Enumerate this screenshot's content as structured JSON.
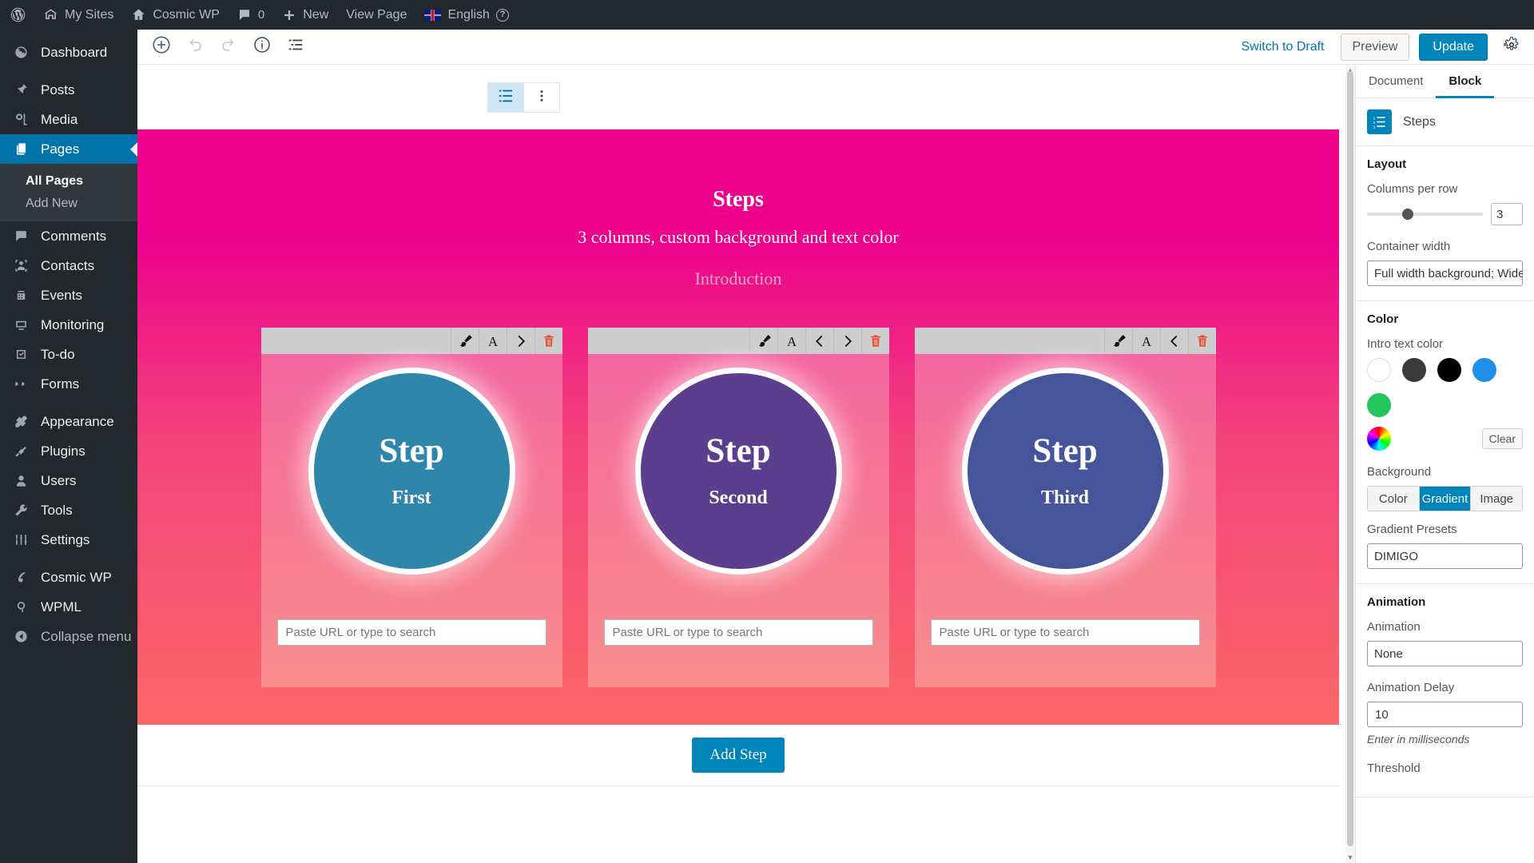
{
  "adminbar": {
    "logo_icon": "wordpress-logo-icon",
    "items": [
      {
        "label": "My Sites",
        "icon": "sites-icon"
      },
      {
        "label": "Cosmic WP",
        "icon": "home-icon"
      },
      {
        "label": "0",
        "icon": "comment-bubble-icon"
      },
      {
        "label": "New",
        "icon": "plus-icon"
      },
      {
        "label": "View Page",
        "icon": ""
      },
      {
        "label": "English",
        "icon": "uk-flag-icon"
      }
    ],
    "help_icon": "help-circle-icon"
  },
  "adminmenu": {
    "items": [
      {
        "label": "Dashboard",
        "icon": "dashboard-icon",
        "active": false
      },
      {
        "label": "Posts",
        "icon": "pin-icon",
        "active": false
      },
      {
        "label": "Media",
        "icon": "media-icon",
        "active": false
      },
      {
        "label": "Pages",
        "icon": "pages-icon",
        "active": true
      },
      {
        "label": "Comments",
        "icon": "comment-icon",
        "active": false
      },
      {
        "label": "Contacts",
        "icon": "contacts-icon",
        "active": false
      },
      {
        "label": "Events",
        "icon": "events-icon",
        "active": false
      },
      {
        "label": "Monitoring",
        "icon": "monitoring-icon",
        "active": false
      },
      {
        "label": "To-do",
        "icon": "todo-icon",
        "active": false
      },
      {
        "label": "Forms",
        "icon": "forms-icon",
        "active": false
      },
      {
        "label": "Appearance",
        "icon": "appearance-icon",
        "active": false
      },
      {
        "label": "Plugins",
        "icon": "plugins-icon",
        "active": false
      },
      {
        "label": "Users",
        "icon": "users-icon",
        "active": false
      },
      {
        "label": "Tools",
        "icon": "tools-icon",
        "active": false
      },
      {
        "label": "Settings",
        "icon": "settings-icon",
        "active": false
      },
      {
        "label": "Cosmic WP",
        "icon": "cosmic-wp-icon",
        "active": false
      },
      {
        "label": "WPML",
        "icon": "wpml-icon",
        "active": false
      }
    ],
    "submenu": {
      "all_pages": "All Pages",
      "add_new": "Add New"
    },
    "collapse": {
      "label": "Collapse menu",
      "icon": "collapse-arrow-icon"
    }
  },
  "editor_header": {
    "tools": [
      {
        "name": "add-block-button",
        "icon": "plus-circle-icon"
      },
      {
        "name": "undo-button",
        "icon": "undo-arrow-icon"
      },
      {
        "name": "redo-button",
        "icon": "redo-arrow-icon"
      },
      {
        "name": "content-info-button",
        "icon": "info-circle-icon"
      },
      {
        "name": "block-navigation-button",
        "icon": "list-view-icon"
      }
    ],
    "switch_to_draft": "Switch to Draft",
    "preview": "Preview",
    "update": "Update",
    "settings_gear_icon": "gear-icon"
  },
  "block_toolbar": {
    "block_type_icon": "steps-block-icon",
    "more_options_icon": "vertical-dots-icon"
  },
  "steps_block": {
    "title": "Steps",
    "subtitle": "3 columns, custom background and text color",
    "intro": "Introduction",
    "add_step_label": "Add Step",
    "url_placeholder": "Paste URL or type to search",
    "cards": [
      {
        "step_label": "Step",
        "name": "First",
        "circle_color": "#2e86ab",
        "tools": [
          "brush-icon",
          "typography-icon",
          "chevron-right-icon",
          "trash-icon"
        ]
      },
      {
        "step_label": "Step",
        "name": "Second",
        "circle_color": "#5b3f8e",
        "tools": [
          "brush-icon",
          "typography-icon",
          "chevron-left-icon",
          "chevron-right-icon",
          "trash-icon"
        ]
      },
      {
        "step_label": "Step",
        "name": "Third",
        "circle_color": "#46549a",
        "tools": [
          "brush-icon",
          "typography-icon",
          "chevron-left-icon",
          "trash-icon"
        ]
      }
    ]
  },
  "settings": {
    "tabs": [
      {
        "label": "Document",
        "active": false
      },
      {
        "label": "Block",
        "active": true
      }
    ],
    "block_name": "Steps",
    "block_icon": "steps-list-icon",
    "layout": {
      "title": "Layout",
      "columns_label": "Columns per row",
      "columns_value": "3",
      "container_width_label": "Container width",
      "container_width_value": "Full width background; Wide content"
    },
    "color": {
      "title": "Color",
      "intro_text_color_label": "Intro text color",
      "swatches": [
        "#ffffff",
        "#3a3a3a",
        "#000000",
        "#1e90e8",
        "#22c55e",
        "rainbow-gradient"
      ],
      "clear_label": "Clear",
      "background_label": "Background",
      "bg_options": [
        {
          "label": "Color",
          "on": false
        },
        {
          "label": "Gradient",
          "on": true
        },
        {
          "label": "Image",
          "on": false
        }
      ],
      "gradient_presets_label": "Gradient Presets",
      "gradient_preset_value": "DIMIGO"
    },
    "animation": {
      "title": "Animation",
      "animation_label": "Animation",
      "animation_value": "None",
      "delay_label": "Animation Delay",
      "delay_value": "10",
      "delay_help": "Enter in milliseconds",
      "threshold_label": "Threshold"
    }
  }
}
